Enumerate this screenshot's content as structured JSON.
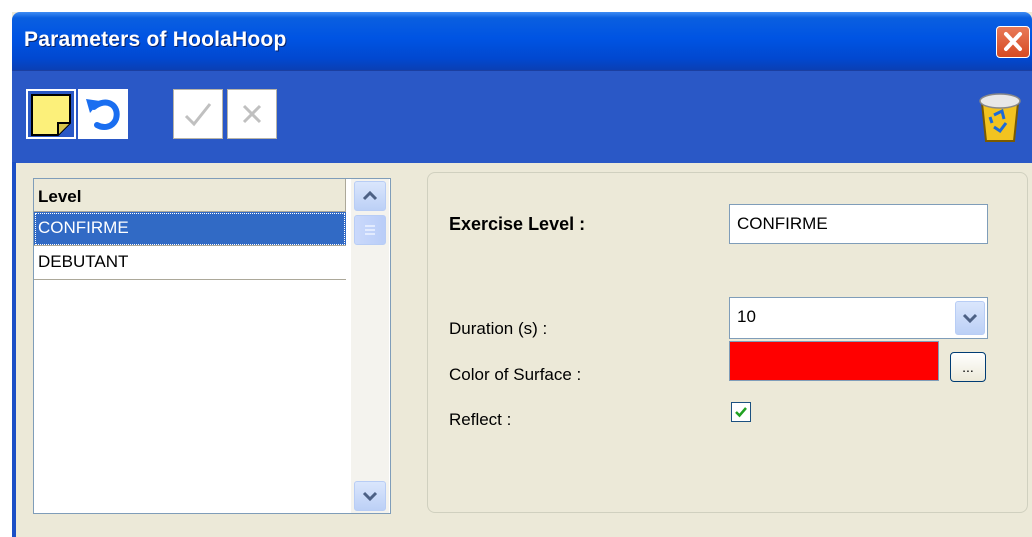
{
  "window": {
    "title": "Parameters of HoolaHoop"
  },
  "toolbar": {
    "buttons": [
      {
        "icon": "new-note-icon",
        "enabled": true
      },
      {
        "icon": "undo-arrow-icon",
        "enabled": true
      },
      {
        "icon": "checkmark-icon",
        "enabled": false
      },
      {
        "icon": "cancel-x-icon",
        "enabled": false
      }
    ],
    "right_icon": "recycle-bin-icon"
  },
  "level_list": {
    "header": "Level",
    "items": [
      {
        "label": "CONFIRME",
        "selected": true
      },
      {
        "label": "DEBUTANT",
        "selected": false
      }
    ]
  },
  "form": {
    "exercise_level_label": "Exercise Level :",
    "exercise_level_value": "CONFIRME",
    "duration_label": "Duration (s) :",
    "duration_value": "10",
    "color_label": "Color of Surface :",
    "color_value": "#ff0000",
    "color_button_label": "...",
    "reflect_label": "Reflect :",
    "reflect_checked": true
  },
  "colors": {
    "titlebar": "#0054e3",
    "toolbar": "#2a58c6",
    "selection": "#316ac5",
    "surface_color": "#ff0000"
  }
}
